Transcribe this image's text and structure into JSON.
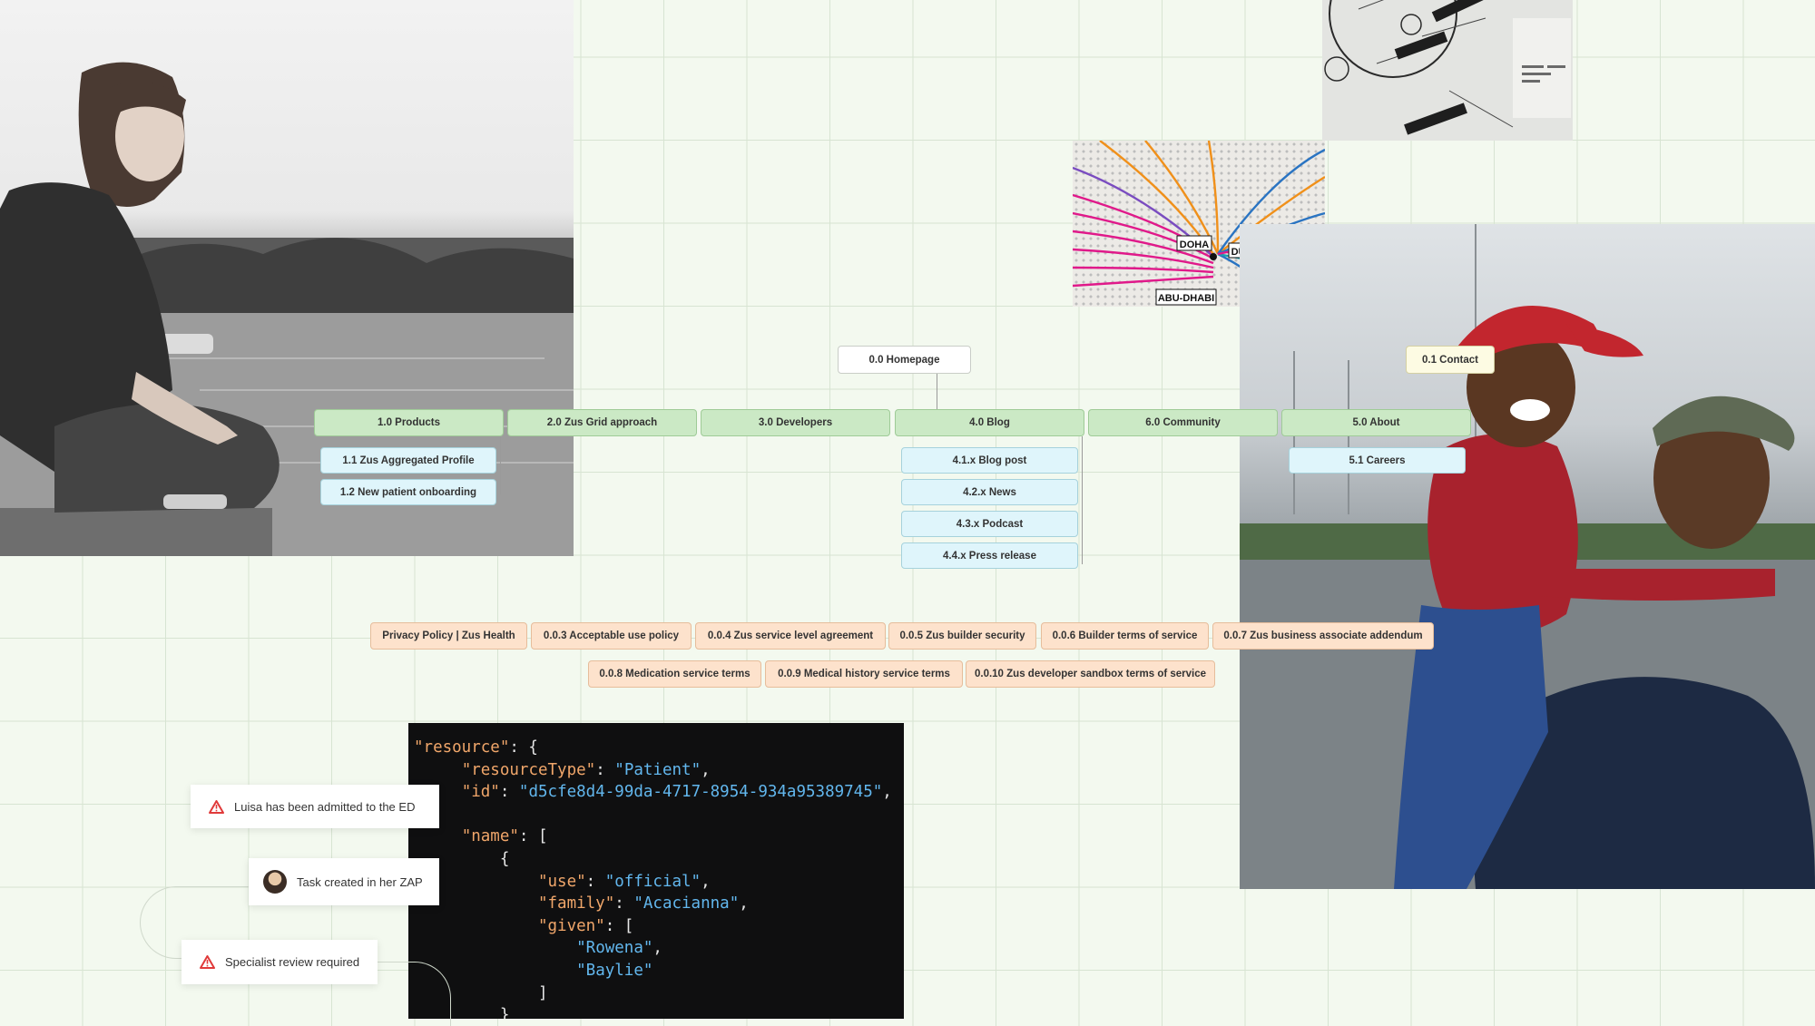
{
  "sitemap": {
    "top": {
      "homepage": "0.0 Homepage",
      "contact": "0.1 Contact"
    },
    "sections": [
      "1.0 Products",
      "2.0 Zus Grid approach",
      "3.0 Developers",
      "4.0 Blog",
      "6.0 Community",
      "5.0 About"
    ],
    "products_children": [
      "1.1 Zus Aggregated Profile",
      "1.2 New patient onboarding"
    ],
    "blog_children": [
      "4.1.x Blog post",
      "4.2.x News",
      "4.3.x Podcast",
      "4.4.x Press release"
    ],
    "about_children": [
      "5.1 Careers"
    ],
    "legal_row1": [
      "Privacy Policy | Zus Health",
      "0.0.3 Acceptable use policy",
      "0.0.4 Zus service level agreement",
      "0.0.5 Zus builder security",
      "0.0.6 Builder terms of service",
      "0.0.7 Zus business associate addendum"
    ],
    "legal_row2": [
      "0.0.8 Medication service terms",
      "0.0.9 Medical history service terms",
      "0.0.10 Zus developer sandbox terms of service"
    ]
  },
  "map_labels": {
    "doha": "DOHA",
    "dubai": "DUBAI",
    "abu_dhabi": "ABU-DHABI"
  },
  "code": {
    "l1_key": "\"resource\"",
    "l1_rest": ": {",
    "l2_key": "\"resourceType\"",
    "l2_sep": ": ",
    "l2_val": "\"Patient\"",
    "l2_end": ",",
    "l3_key": "\"id\"",
    "l3_sep": ": ",
    "l3_val": "\"d5cfe8d4-99da-4717-8954-934a95389745\"",
    "l3_end": ",",
    "l5_key": "\"name\"",
    "l5_rest": ": [",
    "l6": "{",
    "l7_key": "\"use\"",
    "l7_sep": ": ",
    "l7_val": "\"official\"",
    "l7_end": ",",
    "l8_key": "\"family\"",
    "l8_sep": ": ",
    "l8_val": "\"Acacianna\"",
    "l8_end": ",",
    "l9_key": "\"given\"",
    "l9_rest": ": [",
    "l10_val": "\"Rowena\"",
    "l10_end": ",",
    "l11_val": "\"Baylie\"",
    "l12": "]",
    "l13": "}"
  },
  "notifications": {
    "admitted": "Luisa has been admitted to the ED",
    "task": "Task created in her ZAP",
    "review": "Specialist review required"
  },
  "colors": {
    "alert": "#e03a3a",
    "code_key": "#f0a66a",
    "code_string": "#62b7ee"
  }
}
